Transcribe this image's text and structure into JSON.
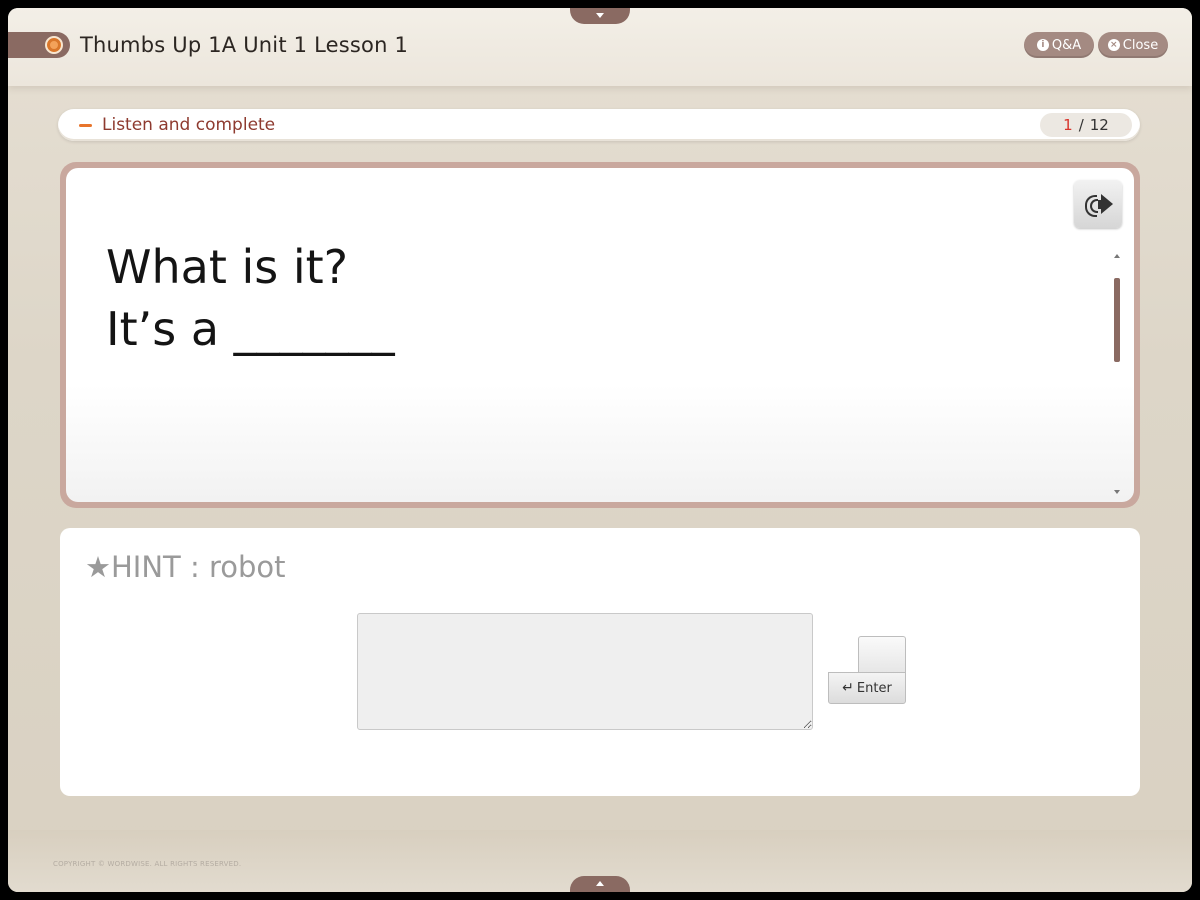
{
  "header": {
    "title": "Thumbs Up 1A Unit 1 Lesson 1",
    "qa_label": "Q&A",
    "close_label": "Close"
  },
  "instruction": {
    "text": "Listen and complete",
    "current_page": "1",
    "separator": "/",
    "total_pages": "12"
  },
  "question": {
    "line1": "What is it?",
    "line2": "It’s a _______"
  },
  "hint": {
    "text": "★HINT : robot"
  },
  "answer": {
    "value": "",
    "placeholder": "",
    "enter_label": "Enter",
    "enter_arrow": "↵"
  },
  "footer": {
    "copyright": "COPYRIGHT © WORDWISE. ALL RIGHTS RESERVED."
  },
  "colors": {
    "accent_brown": "#8a6a62",
    "instruction_red": "#8e3a2f",
    "page_current_red": "#d8342c",
    "orange_dash": "#e8752c"
  },
  "icons": {
    "logo": "orange-ring-icon",
    "sound": "speaker-icon",
    "qa": "info-icon",
    "close": "close-circle-icon",
    "enter": "return-arrow-icon"
  }
}
